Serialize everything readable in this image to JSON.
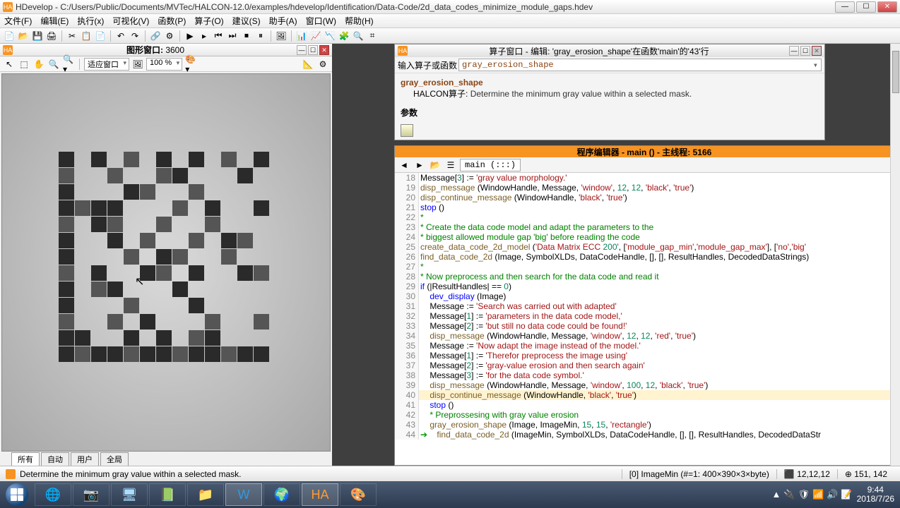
{
  "window": {
    "app_icon": "HA",
    "title": "HDevelop - C:/Users/Public/Documents/MVTec/HALCON-12.0/examples/hdevelop/Identification/Data-Code/2d_data_codes_minimize_module_gaps.hdev"
  },
  "menu": [
    "文件(F)",
    "编辑(E)",
    "执行(x)",
    "可视化(V)",
    "函数(P)",
    "算子(O)",
    "建议(S)",
    "助手(A)",
    "窗口(W)",
    "帮助(H)"
  ],
  "toolbar_icons": [
    "📄",
    "📂",
    "💾",
    "🖨",
    "│",
    "✂",
    "📋",
    "📄",
    "│",
    "↶",
    "↷",
    "│",
    "🔗",
    "⚙",
    "│",
    "▶",
    "▸",
    "⏮",
    "⏭",
    "⏹",
    "⏸",
    "│",
    "🖼",
    "│",
    "📊",
    "📈",
    "📉",
    "🧩",
    "🔍",
    "⌗"
  ],
  "graphics_window": {
    "title_label": "图形窗口:",
    "id": "3600",
    "toolbar": {
      "fit_label": "适应窗口",
      "zoom_label": "100 %"
    },
    "tabs": [
      "所有",
      "自动",
      "用户",
      "全局"
    ]
  },
  "operator_window": {
    "title": "算子窗口 - 编辑:  'gray_erosion_shape'在函数'main'的'43'行",
    "input_label": "输入算子或函数",
    "input_value": "gray_erosion_shape",
    "func_name": "gray_erosion_shape",
    "desc_prefix": "HALCON算子:",
    "desc": "Determine the minimum gray value within a selected mask.",
    "params_label": "参数"
  },
  "editor": {
    "title": "程序编辑器 - main () - 主线程: 5166",
    "location": "main (:::)",
    "first_line": 18,
    "lines": [
      {
        "t": "Message[3] := 'gray value morphology.'"
      },
      {
        "t": "disp_message (WindowHandle, Message, 'window', 12, 12, 'black', 'true')"
      },
      {
        "t": "disp_continue_message (WindowHandle, 'black', 'true')"
      },
      {
        "t": "stop ()"
      },
      {
        "t": "*",
        "cm": true
      },
      {
        "t": "* Create the data code model and adapt the parameters to the",
        "cm": true
      },
      {
        "t": "* biggest allowed module gap 'big' before reading the code",
        "cm": true
      },
      {
        "t": "create_data_code_2d_model ('Data Matrix ECC 200', ['module_gap_min','module_gap_max'], ['no','big'"
      },
      {
        "t": "find_data_code_2d (Image, SymbolXLDs, DataCodeHandle, [], [], ResultHandles, DecodedDataStrings)"
      },
      {
        "t": "*",
        "cm": true
      },
      {
        "t": "* Now preprocess and then search for the data code and read it",
        "cm": true
      },
      {
        "t": "if (|ResultHandles| == 0)"
      },
      {
        "t": "    dev_display (Image)"
      },
      {
        "t": "    Message := 'Search was carried out with adapted'"
      },
      {
        "t": "    Message[1] := 'parameters in the data code model,'"
      },
      {
        "t": "    Message[2] := 'but still no data code could be found!'"
      },
      {
        "t": "    disp_message (WindowHandle, Message, 'window', 12, 12, 'red', 'true')"
      },
      {
        "t": "    Message := 'Now adapt the image instead of the model.'"
      },
      {
        "t": "    Message[1] := 'Therefor preprocess the image using'"
      },
      {
        "t": "    Message[2] := 'gray-value erosion and then search again'"
      },
      {
        "t": "    Message[3] := 'for the data code symbol.'"
      },
      {
        "t": "    disp_message (WindowHandle, Message, 'window', 100, 12, 'black', 'true')"
      },
      {
        "t": "    disp_continue_message (WindowHandle, 'black', 'true')",
        "hl": true
      },
      {
        "t": "    stop ()"
      },
      {
        "t": "    * Preprossesing with gray value erosion",
        "cm": true
      },
      {
        "t": "    gray_erosion_shape (Image, ImageMin, 15, 15, 'rectangle')"
      },
      {
        "t": "    find_data_code_2d (ImageMin, SymbolXLDs, DataCodeHandle, [], [], ResultHandles, DecodedDataStr",
        "arrow": true
      }
    ]
  },
  "status": {
    "text": "Determine the minimum gray value within a selected mask.",
    "mid": "[0] ImageMin (#=1: 400×390×3×byte)",
    "rgb_icon": "⬛",
    "rgb": "12,12,12",
    "pos_icon": "⊕",
    "pos": "151, 142"
  },
  "taskbar": {
    "apps": [
      {
        "glyph": "🌐",
        "c": "#7fd"
      },
      {
        "glyph": "📷",
        "c": "#adf"
      },
      {
        "glyph": "🖥",
        "c": "#adf"
      },
      {
        "glyph": "📗",
        "c": "#7d5"
      },
      {
        "glyph": "📁",
        "c": "#fd8"
      },
      {
        "glyph": "W",
        "c": "#39d",
        "active": true
      },
      {
        "glyph": "🌍",
        "c": "#48c"
      },
      {
        "glyph": "HA",
        "c": "#f93",
        "active": true
      },
      {
        "glyph": "🎨",
        "c": "#fcd"
      }
    ],
    "tray_icons": [
      "▲",
      "🔌",
      "🛡",
      "📶",
      "🔊",
      "📝"
    ],
    "time": "9:44",
    "date": "2018/7/26"
  },
  "dots": [
    [
      0,
      0
    ],
    [
      2,
      0
    ],
    [
      4,
      0
    ],
    [
      6,
      0
    ],
    [
      8,
      0
    ],
    [
      10,
      0
    ],
    [
      12,
      0
    ],
    [
      0,
      1
    ],
    [
      3,
      1
    ],
    [
      6,
      1
    ],
    [
      7,
      1
    ],
    [
      11,
      1
    ],
    [
      0,
      2
    ],
    [
      4,
      2
    ],
    [
      5,
      2
    ],
    [
      8,
      2
    ],
    [
      0,
      3
    ],
    [
      1,
      3
    ],
    [
      2,
      3
    ],
    [
      3,
      3
    ],
    [
      7,
      3
    ],
    [
      9,
      3
    ],
    [
      12,
      3
    ],
    [
      0,
      4
    ],
    [
      2,
      4
    ],
    [
      3,
      4
    ],
    [
      6,
      4
    ],
    [
      9,
      4
    ],
    [
      0,
      5
    ],
    [
      3,
      5
    ],
    [
      5,
      5
    ],
    [
      8,
      5
    ],
    [
      10,
      5
    ],
    [
      11,
      5
    ],
    [
      0,
      6
    ],
    [
      4,
      6
    ],
    [
      6,
      6
    ],
    [
      7,
      6
    ],
    [
      10,
      6
    ],
    [
      0,
      7
    ],
    [
      2,
      7
    ],
    [
      5,
      7
    ],
    [
      6,
      7
    ],
    [
      8,
      7
    ],
    [
      11,
      7
    ],
    [
      12,
      7
    ],
    [
      0,
      8
    ],
    [
      2,
      8
    ],
    [
      3,
      8
    ],
    [
      7,
      8
    ],
    [
      0,
      9
    ],
    [
      4,
      9
    ],
    [
      8,
      9
    ],
    [
      0,
      10
    ],
    [
      3,
      10
    ],
    [
      5,
      10
    ],
    [
      9,
      10
    ],
    [
      12,
      10
    ],
    [
      0,
      11
    ],
    [
      1,
      11
    ],
    [
      4,
      11
    ],
    [
      6,
      11
    ],
    [
      8,
      11
    ],
    [
      9,
      11
    ],
    [
      0,
      12
    ],
    [
      1,
      12
    ],
    [
      2,
      12
    ],
    [
      3,
      12
    ],
    [
      4,
      12
    ],
    [
      5,
      12
    ],
    [
      6,
      12
    ],
    [
      7,
      12
    ],
    [
      8,
      12
    ],
    [
      9,
      12
    ],
    [
      10,
      12
    ],
    [
      11,
      12
    ],
    [
      12,
      12
    ]
  ]
}
